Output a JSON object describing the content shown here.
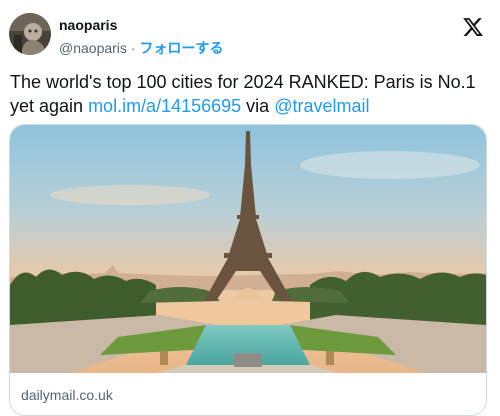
{
  "author": {
    "display_name": "naoparis",
    "handle": "@naoparis",
    "separator": "·",
    "follow_label": "フォローする"
  },
  "tweet": {
    "text_before_link": "The world's top 100 cities for 2024 RANKED: Paris is No.1 yet again ",
    "link_text": "mol.im/a/14156695",
    "text_middle": " via ",
    "mention": "@travelmail"
  },
  "media": {
    "image_subject": "Eiffel Tower and Trocadéro gardens at sunrise",
    "domain": "dailymail.co.uk"
  },
  "icons": {
    "platform_logo": "x-logo-icon",
    "avatar": "avatar-image"
  },
  "colors": {
    "accent": "#1d9bf0",
    "text": "#0f1419",
    "secondary_text": "#536471",
    "border": "#cfd9de"
  }
}
